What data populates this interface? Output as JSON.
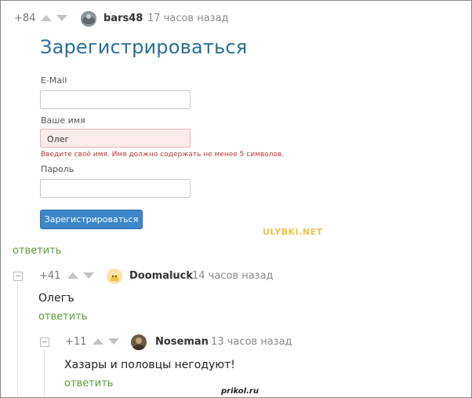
{
  "comments": [
    {
      "rating": "+84",
      "username": "bars48",
      "time": "17 часов назад",
      "reply": "ответить",
      "avatar_icon": "user-avatar-icon"
    },
    {
      "rating": "+41",
      "username": "Doomaluck",
      "time": "14 часов назад",
      "text": "Олегъ",
      "reply": "ответить",
      "avatar_icon": "user-avatar-icon"
    },
    {
      "rating": "+11",
      "username": "Noseman",
      "time": "13 часов назад",
      "text": "Хазары и половцы негодуют!",
      "reply": "ответить",
      "avatar_icon": "user-avatar-icon"
    }
  ],
  "form": {
    "title": "Зарегистрироваться",
    "email_label": "E-Mail",
    "email_value": "",
    "name_label": "Ваше имя",
    "name_value": "Олег",
    "name_error": "Введите своё имя. Имя должно содержать не менее 5 символов.",
    "password_label": "Пароль",
    "password_value": "",
    "submit_label": "Зарегистрироваться"
  },
  "watermark": "ULYBKI.NET",
  "site_mark": "prikol.ru",
  "colors": {
    "reply_link": "#5e9a3e",
    "form_title": "#2b6f95",
    "form_button": "#3c86c9",
    "error_text": "#b73a3a",
    "watermark": "#e8c64a"
  }
}
